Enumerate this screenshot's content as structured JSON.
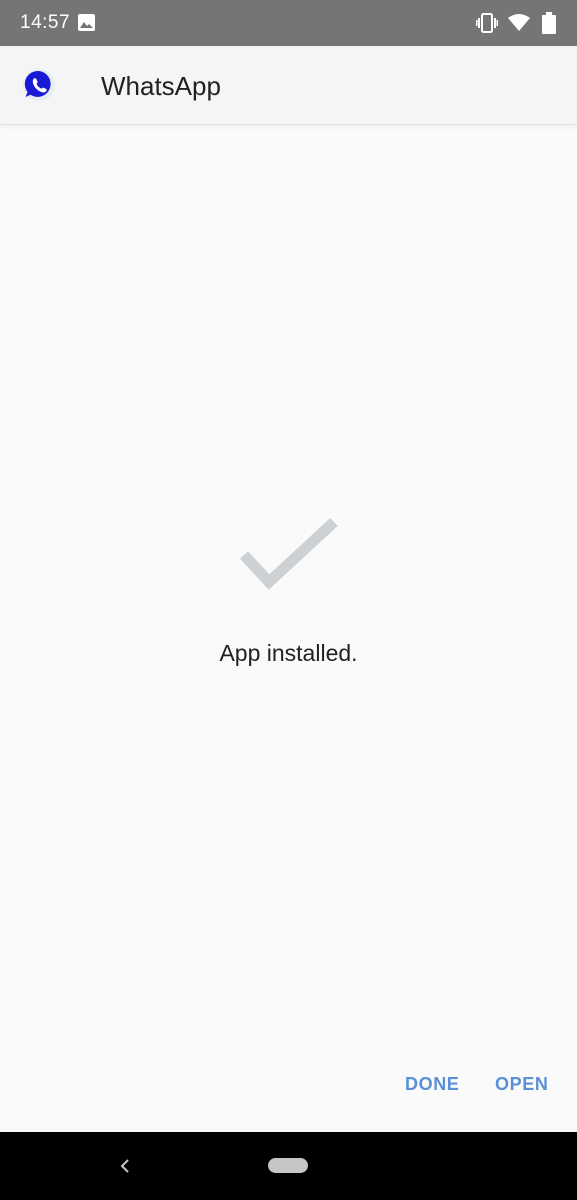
{
  "status_bar": {
    "time": "14:57",
    "icons": [
      "image-icon",
      "vibrate-icon",
      "wifi-icon",
      "battery-icon"
    ]
  },
  "app_bar": {
    "app_name": "WhatsApp",
    "icon": "whatsapp-logo-icon",
    "icon_color": "#1a1ad6"
  },
  "content": {
    "icon": "checkmark-icon",
    "icon_color": "#cdd1d4",
    "message": "App installed."
  },
  "actions": {
    "done_label": "DONE",
    "open_label": "OPEN",
    "accent_color": "#5b8fd6"
  },
  "nav_bar": {
    "back_icon": "back-icon",
    "home_icon": "home-pill-icon"
  }
}
